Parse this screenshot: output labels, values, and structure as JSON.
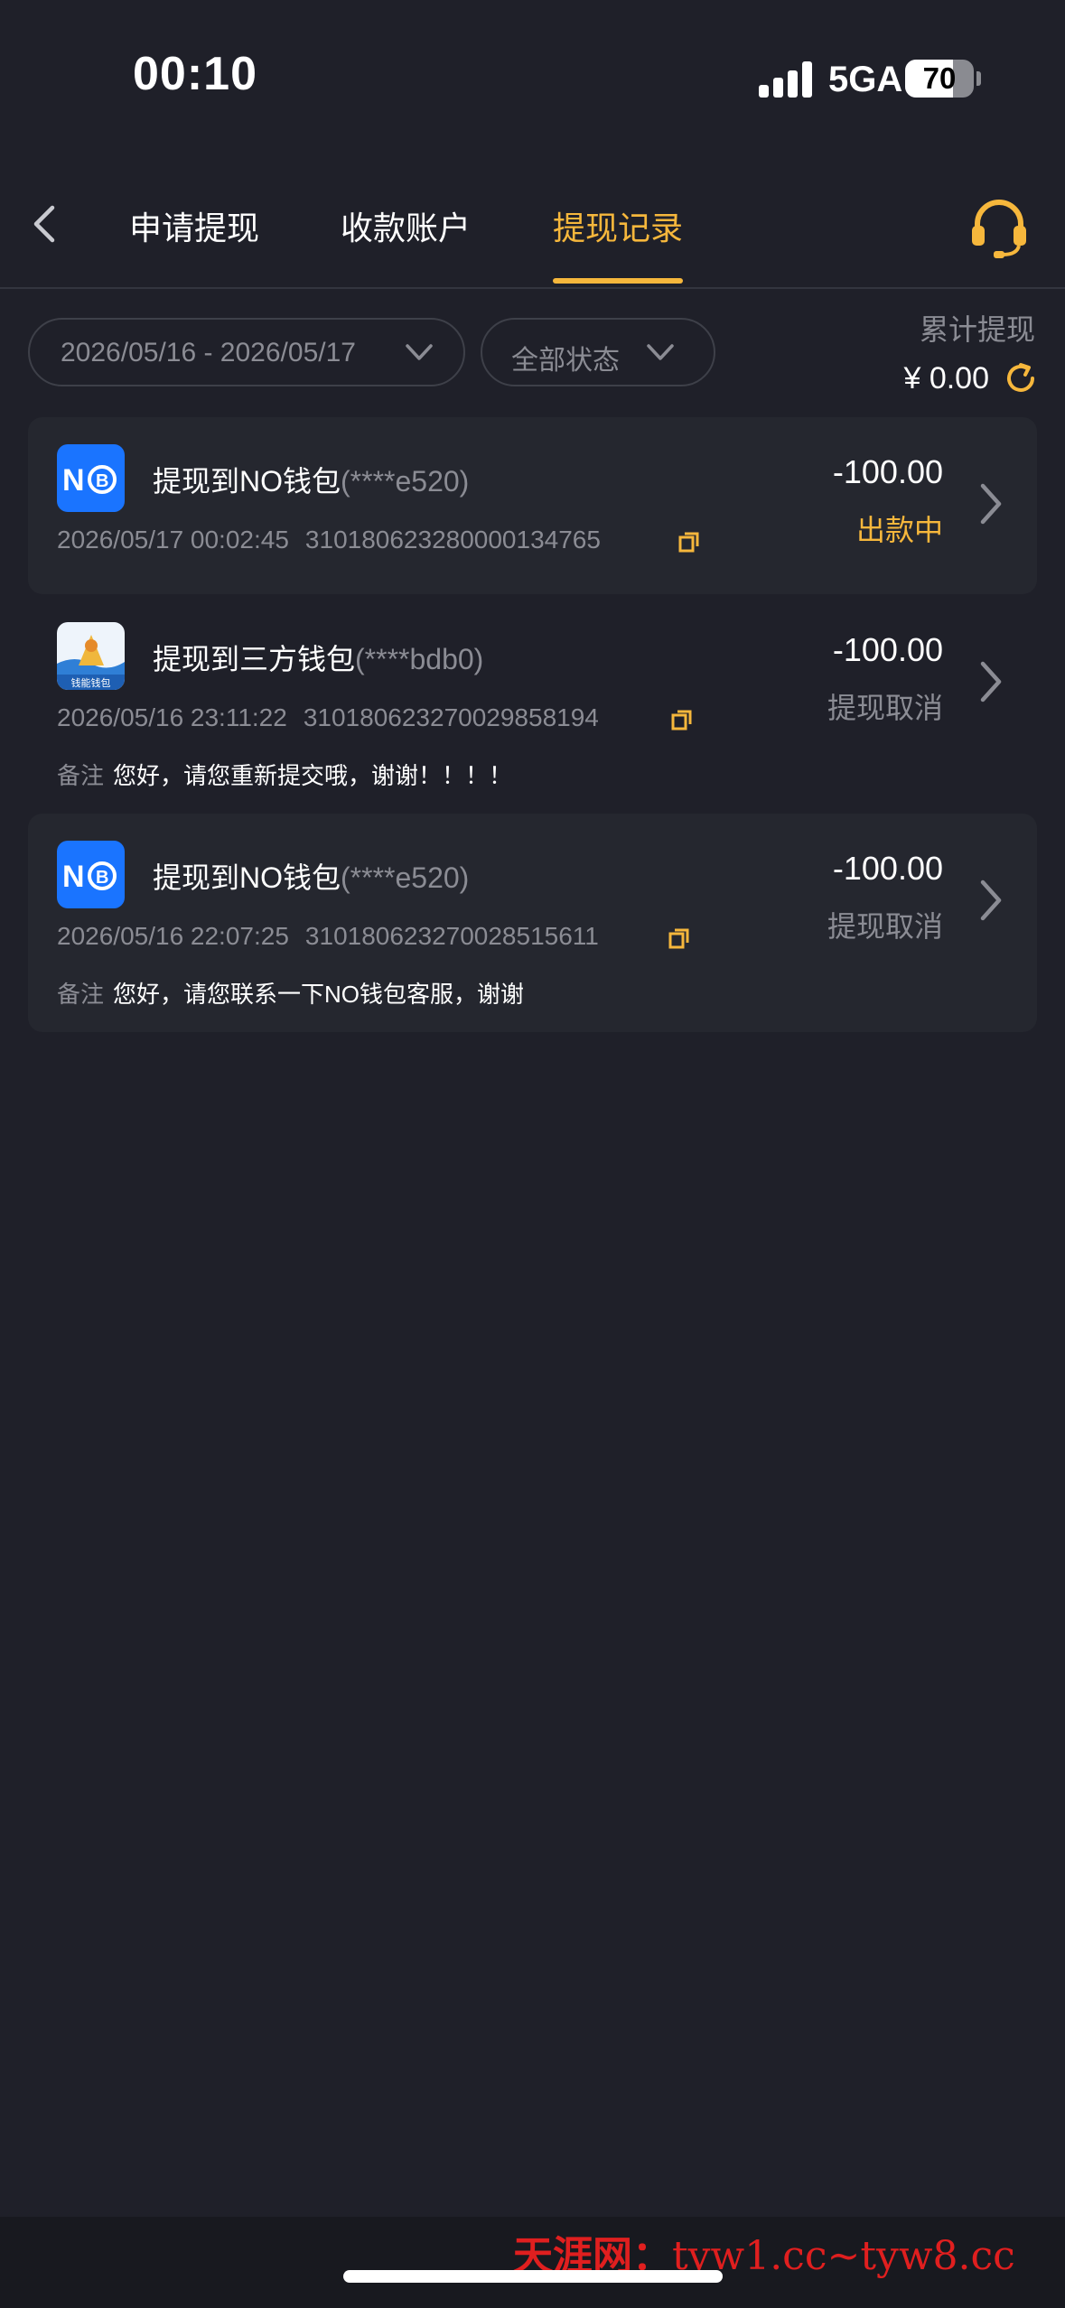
{
  "status_bar": {
    "time": "00:10",
    "network": "5GA",
    "battery": "70",
    "battery_level": 0.7
  },
  "nav": {
    "tabs": [
      "申请提现",
      "收款账户",
      "提现记录"
    ],
    "active_tab": 2
  },
  "filters": {
    "date_range": "2026/05/16 - 2026/05/17",
    "status": "全部状态"
  },
  "summary": {
    "label": "累计提现",
    "value": "¥ 0.00"
  },
  "records": [
    {
      "icon": "no-wallet-logo",
      "title": "提现到NO钱包",
      "account": "(****e520)",
      "datetime": "2026/05/17 00:02:45",
      "order_no": "310180623280000134765",
      "amount": "-100.00",
      "status": "出款中",
      "status_color": "#f6b73c",
      "note_label": "",
      "note": ""
    },
    {
      "icon": "third-party-wallet-logo",
      "title": "提现到三方钱包",
      "account": "(****bdb0)",
      "datetime": "2026/05/16 23:11:22",
      "order_no": "310180623270029858194",
      "amount": "-100.00",
      "status": "提现取消",
      "status_color": "#8b8c94",
      "note_label": "备注",
      "note": "您好，请您重新提交哦，谢谢！！！！"
    },
    {
      "icon": "no-wallet-logo",
      "title": "提现到NO钱包",
      "account": "(****e520)",
      "datetime": "2026/05/16 22:07:25",
      "order_no": "310180623270028515611",
      "amount": "-100.00",
      "status": "提现取消",
      "status_color": "#8b8c94",
      "note_label": "备注",
      "note": "您好，请您联系一下NO钱包客服，谢谢"
    }
  ],
  "watermark": {
    "cn": "天涯网：",
    "url": "tyw1.cc~tyw8.cc"
  },
  "colors": {
    "background": "#1f2029",
    "card": "#25272f",
    "accent": "#f6b73c",
    "muted": "#8b8c94",
    "no_wallet_blue": "#1a74ff"
  },
  "third_party_logo_text": "钱能钱包"
}
